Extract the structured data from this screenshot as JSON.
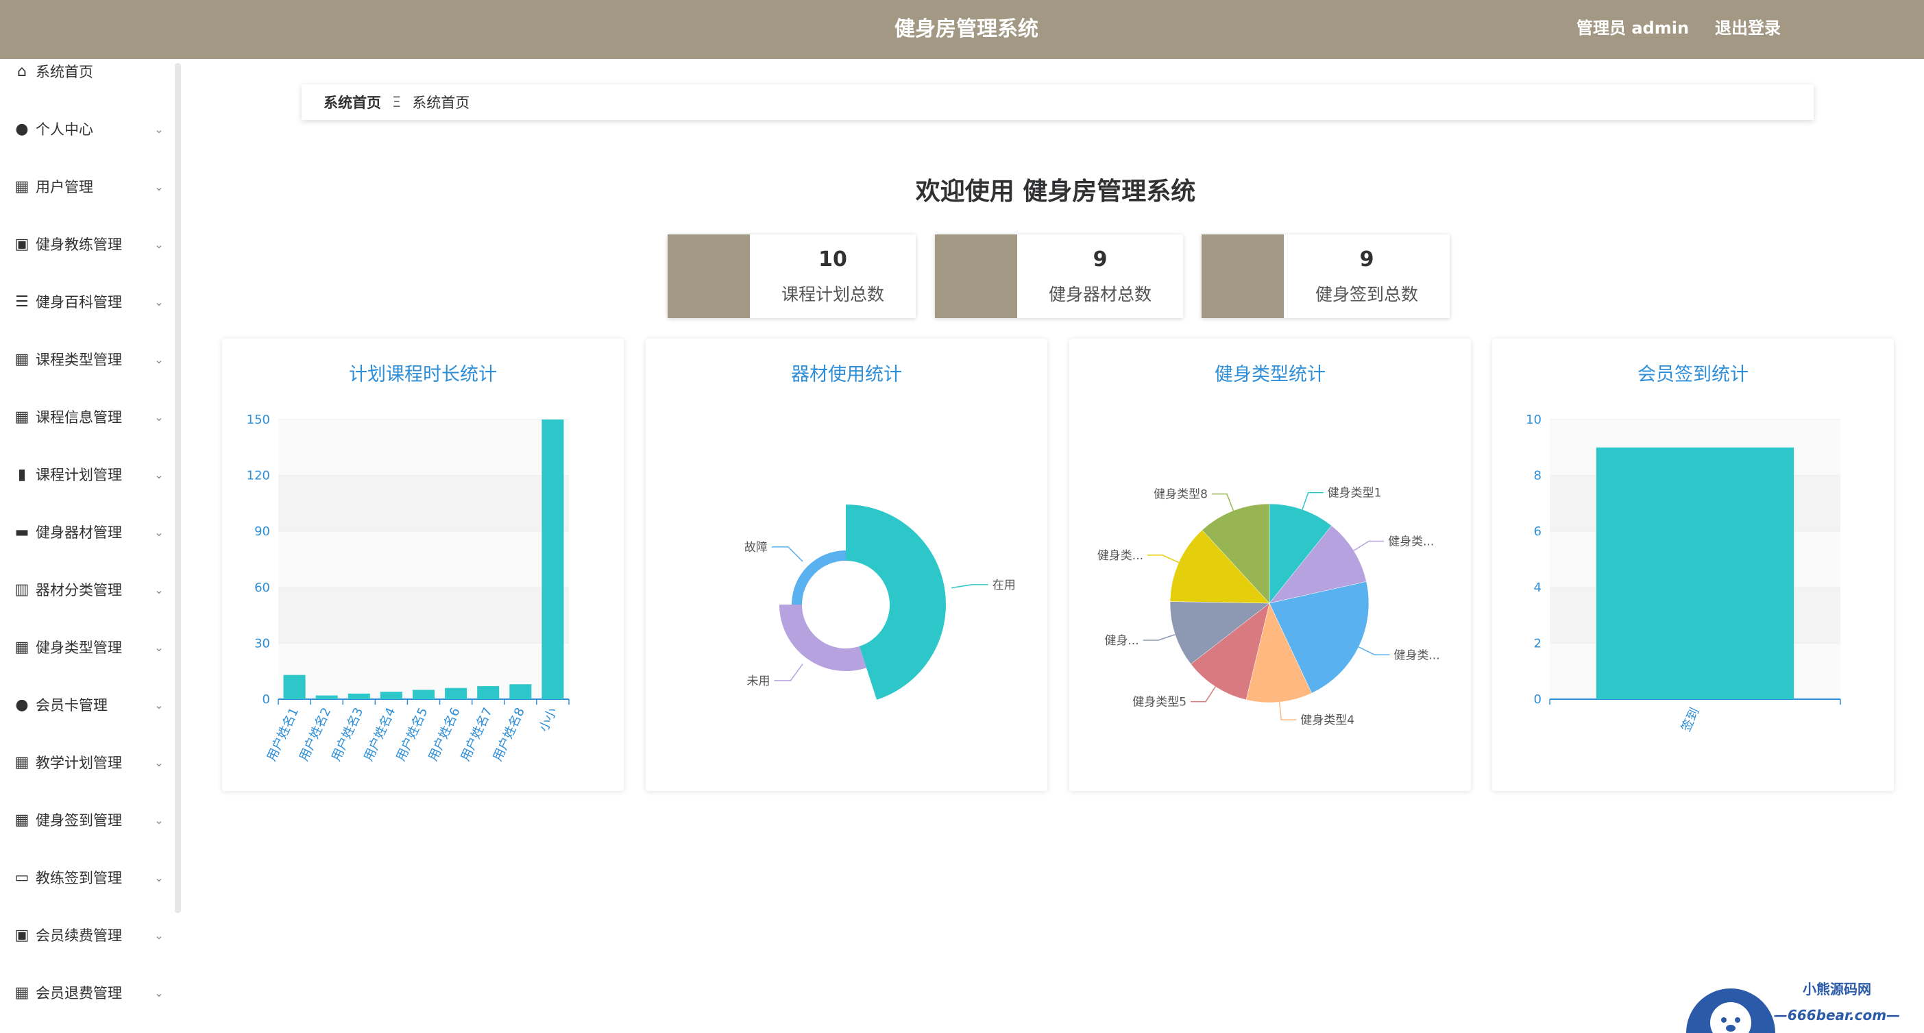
{
  "header": {
    "title": "健身房管理系统",
    "admin": "管理员 admin",
    "logout": "退出登录"
  },
  "sidebar": {
    "items": [
      {
        "label": "系统首页",
        "icon": "home-icon",
        "chevron": false
      },
      {
        "label": "个人中心",
        "icon": "user-icon",
        "chevron": true
      },
      {
        "label": "用户管理",
        "icon": "grid-icon",
        "chevron": true
      },
      {
        "label": "健身教练管理",
        "icon": "clipboard-x-icon",
        "chevron": true
      },
      {
        "label": "健身百科管理",
        "icon": "list-icon",
        "chevron": true
      },
      {
        "label": "课程类型管理",
        "icon": "grid-icon",
        "chevron": true
      },
      {
        "label": "课程信息管理",
        "icon": "grid-icon",
        "chevron": true
      },
      {
        "label": "课程计划管理",
        "icon": "bar-chart-icon",
        "chevron": true
      },
      {
        "label": "健身器材管理",
        "icon": "stand-icon",
        "chevron": true
      },
      {
        "label": "器材分类管理",
        "icon": "books-icon",
        "chevron": true
      },
      {
        "label": "健身类型管理",
        "icon": "grid-icon",
        "chevron": true
      },
      {
        "label": "会员卡管理",
        "icon": "user-icon",
        "chevron": true
      },
      {
        "label": "教学计划管理",
        "icon": "grid-icon",
        "chevron": true
      },
      {
        "label": "健身签到管理",
        "icon": "grid-icon",
        "chevron": true
      },
      {
        "label": "教练签到管理",
        "icon": "monitor-icon",
        "chevron": true
      },
      {
        "label": "会员续费管理",
        "icon": "clipboard-check-icon",
        "chevron": true
      },
      {
        "label": "会员退费管理",
        "icon": "grid-icon",
        "chevron": true
      }
    ]
  },
  "breadcrumb": {
    "home": "系统首页",
    "separator": "Ξ",
    "current": "系统首页"
  },
  "welcome": "欢迎使用 健身房管理系统",
  "stats": [
    {
      "value": "10",
      "label": "课程计划总数"
    },
    {
      "value": "9",
      "label": "健身器材总数"
    },
    {
      "value": "9",
      "label": "健身签到总数"
    }
  ],
  "colors": {
    "header": "#a39883",
    "accent": "#2e8fd8",
    "bar": "#2ec7c9"
  },
  "panels": [
    "计划课程时长统计",
    "器材使用统计",
    "健身类型统计",
    "会员签到统计"
  ],
  "watermark": {
    "brand": "小熊源码网",
    "url": "—666bear.com—"
  },
  "chart_data": [
    {
      "type": "bar",
      "title": "计划课程时长统计",
      "categories": [
        "用户姓名1",
        "用户姓名2",
        "用户姓名3",
        "用户姓名4",
        "用户姓名5",
        "用户姓名6",
        "用户姓名7",
        "用户姓名8",
        "小小"
      ],
      "values": [
        13,
        2,
        3,
        4,
        5,
        6,
        7,
        8,
        150
      ],
      "ylim": [
        0,
        150
      ],
      "yticks": [
        0,
        30,
        60,
        90,
        120,
        150
      ]
    },
    {
      "type": "pie",
      "title": "器材使用统计",
      "labels": [
        "在用",
        "未用",
        "故障"
      ],
      "values": [
        45,
        30,
        25
      ]
    },
    {
      "type": "pie",
      "title": "健身类型统计",
      "labels": [
        "健身类型1",
        "健身类...",
        "健身类...",
        "健身类型4",
        "健身类型5",
        "健身...",
        "健身类...",
        "健身类型8"
      ],
      "values": [
        10,
        10,
        20,
        10,
        10,
        10,
        12,
        11
      ]
    },
    {
      "type": "bar",
      "title": "会员签到统计",
      "categories": [
        "签到"
      ],
      "values": [
        9
      ],
      "ylim": [
        0,
        10
      ],
      "yticks": [
        0,
        2,
        4,
        6,
        8,
        10
      ]
    }
  ]
}
